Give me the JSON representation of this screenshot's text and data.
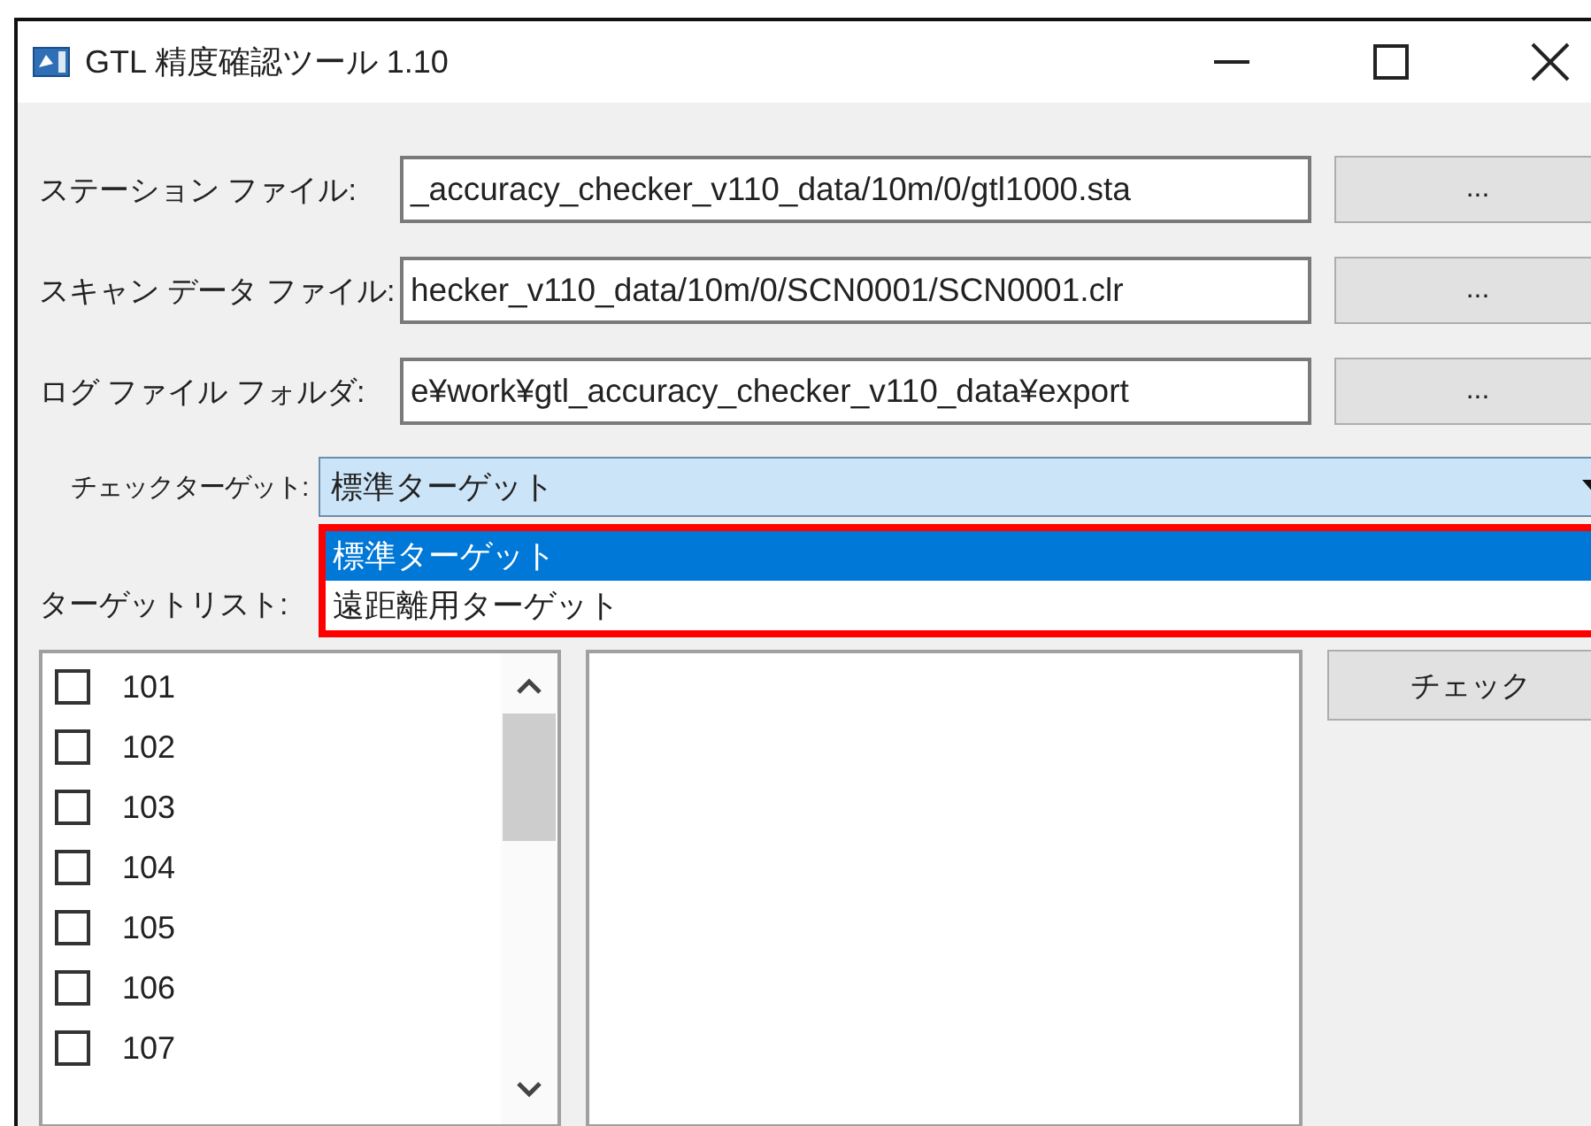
{
  "window": {
    "title": "GTL 精度確認ツール 1.10"
  },
  "file_rows": [
    {
      "label": "ステーション ファイル:",
      "value": "_accuracy_checker_v110_data/10m/0/gtl1000.sta",
      "button": "..."
    },
    {
      "label": "スキャン データ ファイル:",
      "value": "hecker_v110_data/10m/0/SCN0001/SCN0001.clr",
      "button": "..."
    },
    {
      "label": "ログ ファイル フォルダ:",
      "value": "e¥work¥gtl_accuracy_checker_v110_data¥export",
      "button": "..."
    }
  ],
  "check_target": {
    "label": "チェックターゲット:",
    "value": "標準ターゲット",
    "expanded": true,
    "highlighted": true,
    "options": [
      {
        "label": "標準ターゲット",
        "selected": true
      },
      {
        "label": "遠距離用ターゲット",
        "selected": false
      }
    ]
  },
  "target_list": {
    "label": "ターゲットリスト:",
    "items": [
      {
        "label": "101",
        "checked": false
      },
      {
        "label": "102",
        "checked": false
      },
      {
        "label": "103",
        "checked": false
      },
      {
        "label": "104",
        "checked": false
      },
      {
        "label": "105",
        "checked": false
      },
      {
        "label": "106",
        "checked": false
      },
      {
        "label": "107",
        "checked": false
      }
    ]
  },
  "check_button": "チェック"
}
